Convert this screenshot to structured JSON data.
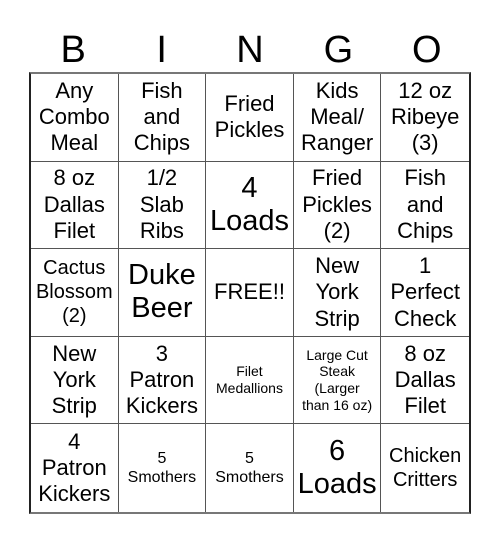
{
  "header": [
    "B",
    "I",
    "N",
    "G",
    "O"
  ],
  "cells": [
    {
      "text": "Any\nCombo\nMeal",
      "size": "s-lg"
    },
    {
      "text": "Fish\nand\nChips",
      "size": "s-lg"
    },
    {
      "text": "Fried\nPickles",
      "size": "s-lg"
    },
    {
      "text": "Kids\nMeal/\nRanger",
      "size": "s-lg"
    },
    {
      "text": "12 oz\nRibeye\n(3)",
      "size": "s-lg"
    },
    {
      "text": "8 oz\nDallas\nFilet",
      "size": "s-lg"
    },
    {
      "text": "1/2\nSlab\nRibs",
      "size": "s-lg"
    },
    {
      "text": "4\nLoads",
      "size": "s-xl"
    },
    {
      "text": "Fried\nPickles\n(2)",
      "size": "s-lg"
    },
    {
      "text": "Fish\nand\nChips",
      "size": "s-lg"
    },
    {
      "text": "Cactus\nBlossom\n(2)",
      "size": "s-md"
    },
    {
      "text": "Duke\nBeer",
      "size": "s-xl"
    },
    {
      "text": "FREE!!",
      "size": "s-lg"
    },
    {
      "text": "New\nYork\nStrip",
      "size": "s-lg"
    },
    {
      "text": "1\nPerfect\nCheck",
      "size": "s-lg"
    },
    {
      "text": "New\nYork\nStrip",
      "size": "s-lg"
    },
    {
      "text": "3\nPatron\nKickers",
      "size": "s-lg"
    },
    {
      "text": "Filet\nMedallions",
      "size": "s-xs"
    },
    {
      "text": "Large Cut\nSteak\n(Larger\nthan 16 oz)",
      "size": "s-xs"
    },
    {
      "text": "8 oz\nDallas\nFilet",
      "size": "s-lg"
    },
    {
      "text": "4\nPatron\nKickers",
      "size": "s-lg"
    },
    {
      "text": "5\nSmothers",
      "size": "s-sm"
    },
    {
      "text": "5\nSmothers",
      "size": "s-sm"
    },
    {
      "text": "6\nLoads",
      "size": "s-xl"
    },
    {
      "text": "Chicken\nCritters",
      "size": "s-md"
    }
  ]
}
